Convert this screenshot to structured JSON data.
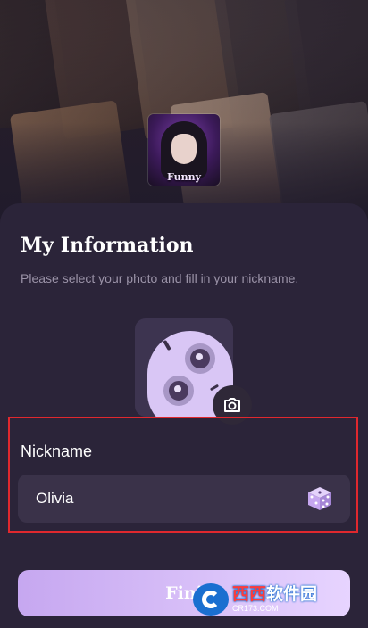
{
  "header": {
    "avatar_label": "Funny"
  },
  "profile": {
    "title": "My Information",
    "subtitle": "Please select your photo and fill in your nickname.",
    "photo_icon": "camera-icon"
  },
  "nickname": {
    "label": "Nickname",
    "value": "Olivia",
    "random_icon": "dice-icon"
  },
  "actions": {
    "finish_label": "Fini"
  },
  "watermark": {
    "main_a": "西西",
    "main_b": "软件园",
    "sub": "CR173.COM"
  },
  "colors": {
    "sheet_bg": "#2b2439",
    "accent": "#c6a7f0",
    "highlight": "#e0282e"
  }
}
